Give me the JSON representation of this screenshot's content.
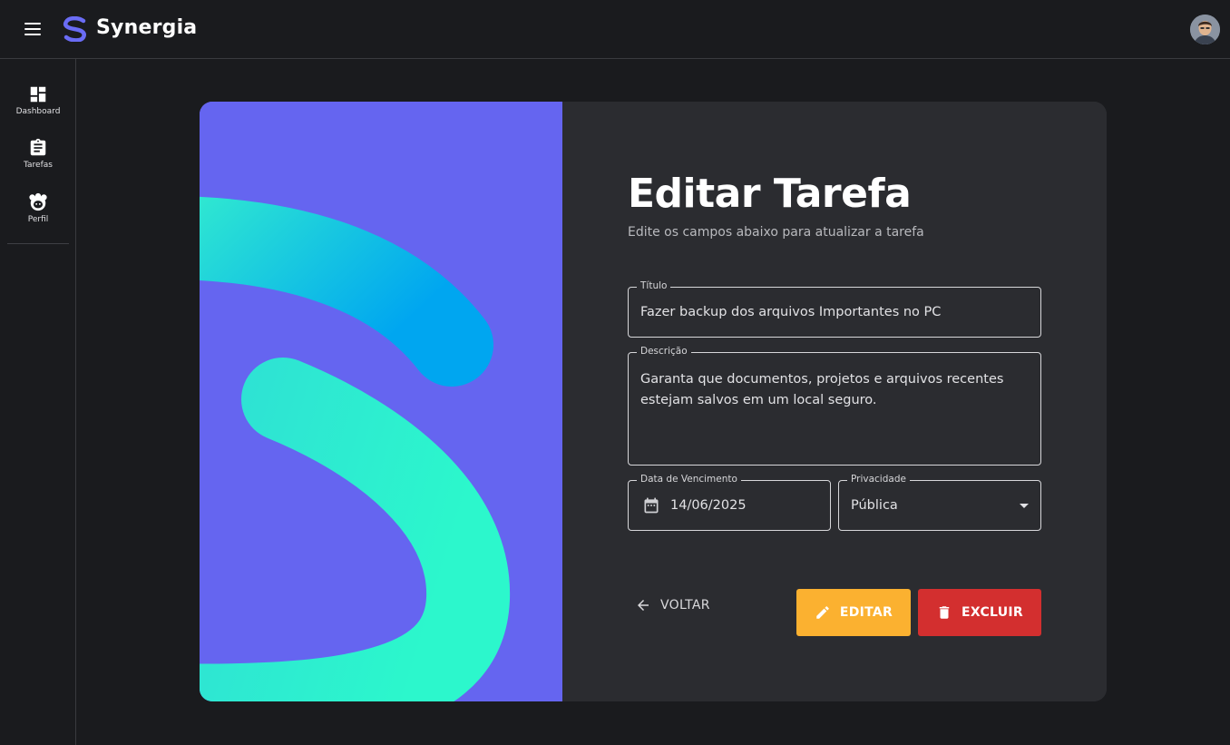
{
  "app": {
    "brand": "Synergia",
    "accent": "#6565f0"
  },
  "sidebar": {
    "items": [
      {
        "label": "Dashboard",
        "icon": "dashboard-icon"
      },
      {
        "label": "Tarefas",
        "icon": "clipboard-icon"
      },
      {
        "label": "Perfil",
        "icon": "profile-icon"
      }
    ]
  },
  "form": {
    "title": "Editar Tarefa",
    "subtitle": "Edite os campos abaixo para atualizar a tarefa",
    "fields": {
      "titulo": {
        "label": "Título",
        "value": "Fazer backup dos arquivos Importantes no PC"
      },
      "descricao": {
        "label": "Descrição",
        "value": "Garanta que documentos, projetos e arquivos recentes estejam salvos em um local seguro."
      },
      "vencimento": {
        "label": "Data de Vencimento",
        "value": "14/06/2025",
        "icon": "calendar-icon"
      },
      "privacidade": {
        "label": "Privacidade",
        "value": "Pública"
      }
    },
    "actions": {
      "back": "VOLTAR",
      "edit": "EDITAR",
      "delete": "EXCLUIR"
    },
    "colors": {
      "edit": "#fbb130",
      "delete": "#d32f2f"
    }
  }
}
